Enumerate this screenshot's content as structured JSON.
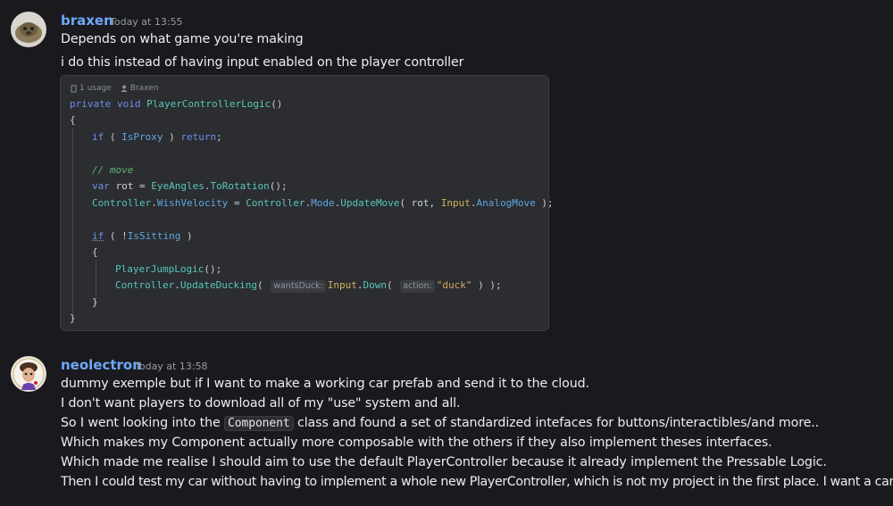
{
  "messages": [
    {
      "username": "braxen",
      "timestamp": "Today at 13:55",
      "lines": [
        "Depends on what game you're making",
        "i do this instead of having input enabled on the player controller"
      ]
    },
    {
      "username": "neolectron",
      "timestamp": "Today at 13:58",
      "lines": [
        "dummy exemple but if I want to make a working car prefab and send it to the cloud.",
        "I don't want players to download all of my \"use\" system and all.",
        "So I went looking into the",
        "Component",
        "class and found a set of standardized intefaces for buttons/interactibles/and more..",
        "Which makes my Component actually more composable with the others if they also implement theses interfaces.",
        "Which made me realise I should aim to use the default PlayerController because it already implement the Pressable Logic.",
        "Then I could test my car without having to implement a whole new PlayerController, which is not my project in the first place. I want a car."
      ]
    }
  ],
  "code": {
    "usage": "1 usage",
    "author": "Braxen",
    "l1_kw": "private void",
    "l1_fn": "PlayerControllerLogic",
    "l1_end": "()",
    "brace_open": "{",
    "brace_close": "}",
    "l3_if": "if",
    "l3_open": " ( ",
    "l3_prop": "IsProxy",
    "l3_close": " ) ",
    "l3_ret": "return",
    "l3_semi": ";",
    "comment": "// move",
    "l6_var": "var",
    "l6_rot": " rot = ",
    "l6_eye": "EyeAngles",
    "l6_dot": ".",
    "l6_to": "ToRotation",
    "l6_end": "();",
    "l7_ctrl": "Controller",
    "l7_dot": ".",
    "l7_wish": "WishVelocity",
    "l7_eq": " = ",
    "l7_ctrl2": "Controller",
    "l7_dot2": ".",
    "l7_mode": "Mode",
    "l7_dot3": ".",
    "l7_upd": "UpdateMove",
    "l7_args": "( rot, ",
    "l7_input": "Input",
    "l7_dot4": ".",
    "l7_analog": "AnalogMove",
    "l7_end": " );",
    "l9_if": "if",
    "l9_rest": " ( !",
    "l9_prop": "IsSitting",
    "l9_end": " )",
    "l10_brace": "{",
    "l11_fn": "PlayerJumpLogic",
    "l11_end": "();",
    "l12_ctrl": "Controller",
    "l12_dot": ".",
    "l12_fn": "UpdateDucking",
    "l12_open": "( ",
    "hint1": "wantsDuck:",
    "l12_input": "Input",
    "l12_dot2": ".",
    "l12_down": "Down",
    "l12_open2": "( ",
    "hint2": "action:",
    "l12_str": "\"duck\"",
    "l12_end": " ) );",
    "l13_brace": "}"
  }
}
